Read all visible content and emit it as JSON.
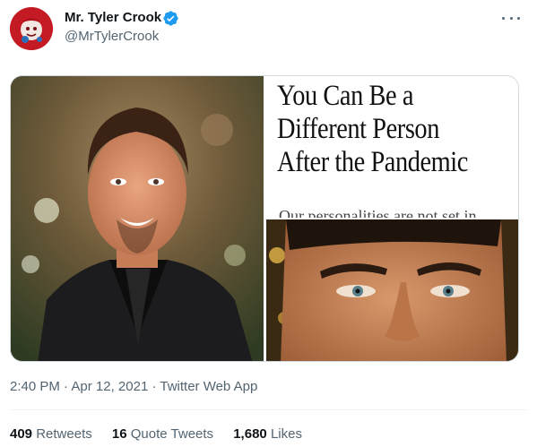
{
  "author": {
    "display_name": "Mr. Tyler Crook",
    "handle": "@MrTylerCrook",
    "verified": true
  },
  "media": {
    "article_headline": [
      "You Can Be a",
      "Different Person",
      "After the Pandemic"
    ],
    "article_subtext": "Our personalities are not set in"
  },
  "timestamp": {
    "time": "2:40 PM",
    "date": "Apr 12, 2021",
    "source": "Twitter Web App"
  },
  "stats": [
    {
      "count": "409",
      "label": "Retweets"
    },
    {
      "count": "16",
      "label": "Quote Tweets"
    },
    {
      "count": "1,680",
      "label": "Likes"
    }
  ],
  "colors": {
    "verified_blue": "#1d9bf0",
    "secondary_text": "#536471",
    "primary_text": "#0f1419"
  }
}
